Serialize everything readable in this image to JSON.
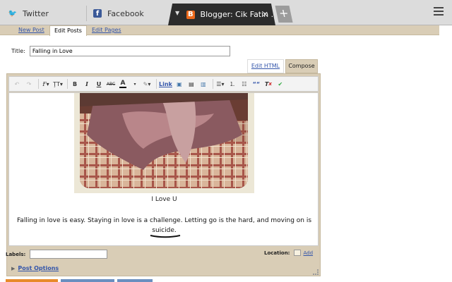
{
  "browser": {
    "tabs": [
      {
        "label": "Twitter",
        "icon": "twitter-icon"
      },
      {
        "label": "Facebook",
        "icon": "facebook-icon"
      },
      {
        "label": "Blogger: Cik Fatin ...",
        "icon": "blogger-icon",
        "active": true
      }
    ],
    "new_tab_label": "+",
    "close_glyph": "✕"
  },
  "blogger": {
    "subtabs": [
      "New Post",
      "Edit Posts",
      "Edit Pages"
    ],
    "active_subtab": "Edit Posts",
    "title_label": "Title:",
    "title_value": "Falling in Love",
    "mode_tabs": {
      "html": "Edit HTML",
      "compose": "Compose"
    },
    "toolbar": {
      "link_label": "Link",
      "bold": "B",
      "italic": "I",
      "underline": "U",
      "strike": "ABC",
      "font_glyph": "Ғ",
      "size_glyph": "ŢT",
      "color_glyph": "A",
      "quote_glyph": "““",
      "clear_glyph": "T"
    },
    "content": {
      "caption": "I Love U",
      "body_line1": "Falling in love is easy.  Staying in love is a challenge.  Letting go is the hard, and moving on is",
      "body_line2": "suicide."
    },
    "labels_label": "Labels:",
    "location_label": "Location:",
    "location_add": "Add",
    "post_options": "Post Options"
  },
  "colors": {
    "accent_beige": "#d9cdb6",
    "link_blue": "#3355aa",
    "active_tab": "#2c2c2c",
    "blogger_orange": "#ee6a1c"
  }
}
